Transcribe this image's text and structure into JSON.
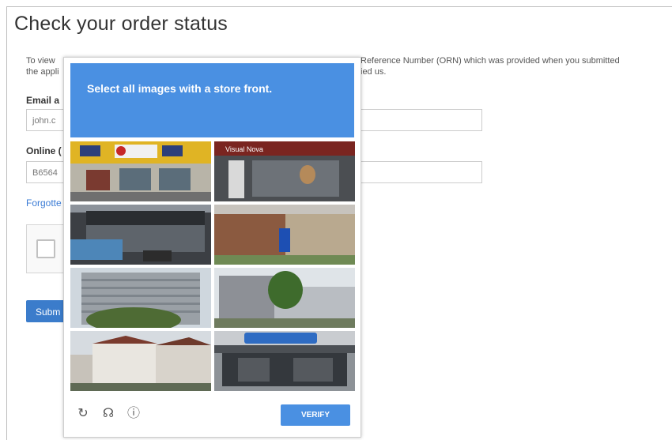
{
  "page": {
    "title": "Check your order status",
    "intro_line1": "To view",
    "intro_line2": "the appli",
    "intro_right_line1": "Reference Number (ORN) which was provided when you submitted",
    "intro_right_line2": "ied us.",
    "email_label": "Email a",
    "email_value": "john.c",
    "orn_label": "Online (",
    "orn_value": "B6564",
    "forgot_link": "Forgotte",
    "submit_label": "Subm"
  },
  "captcha": {
    "prompt_prefix": "Select all images with a ",
    "prompt_target": "store front",
    "prompt_suffix": ".",
    "verify_label": "VERIFY",
    "footer_icons": [
      "reload-icon",
      "audio-icon",
      "info-icon"
    ],
    "tiles": [
      {
        "name": "tile-1"
      },
      {
        "name": "tile-2"
      },
      {
        "name": "tile-3"
      },
      {
        "name": "tile-4"
      },
      {
        "name": "tile-5"
      },
      {
        "name": "tile-6"
      },
      {
        "name": "tile-7"
      },
      {
        "name": "tile-8"
      }
    ],
    "tile_signs": {
      "tile2_sign": "Visual Nova"
    }
  },
  "colors": {
    "captcha_blue": "#4a90e2",
    "link_blue": "#3a7bd5",
    "button_blue": "#3b7ccb"
  }
}
